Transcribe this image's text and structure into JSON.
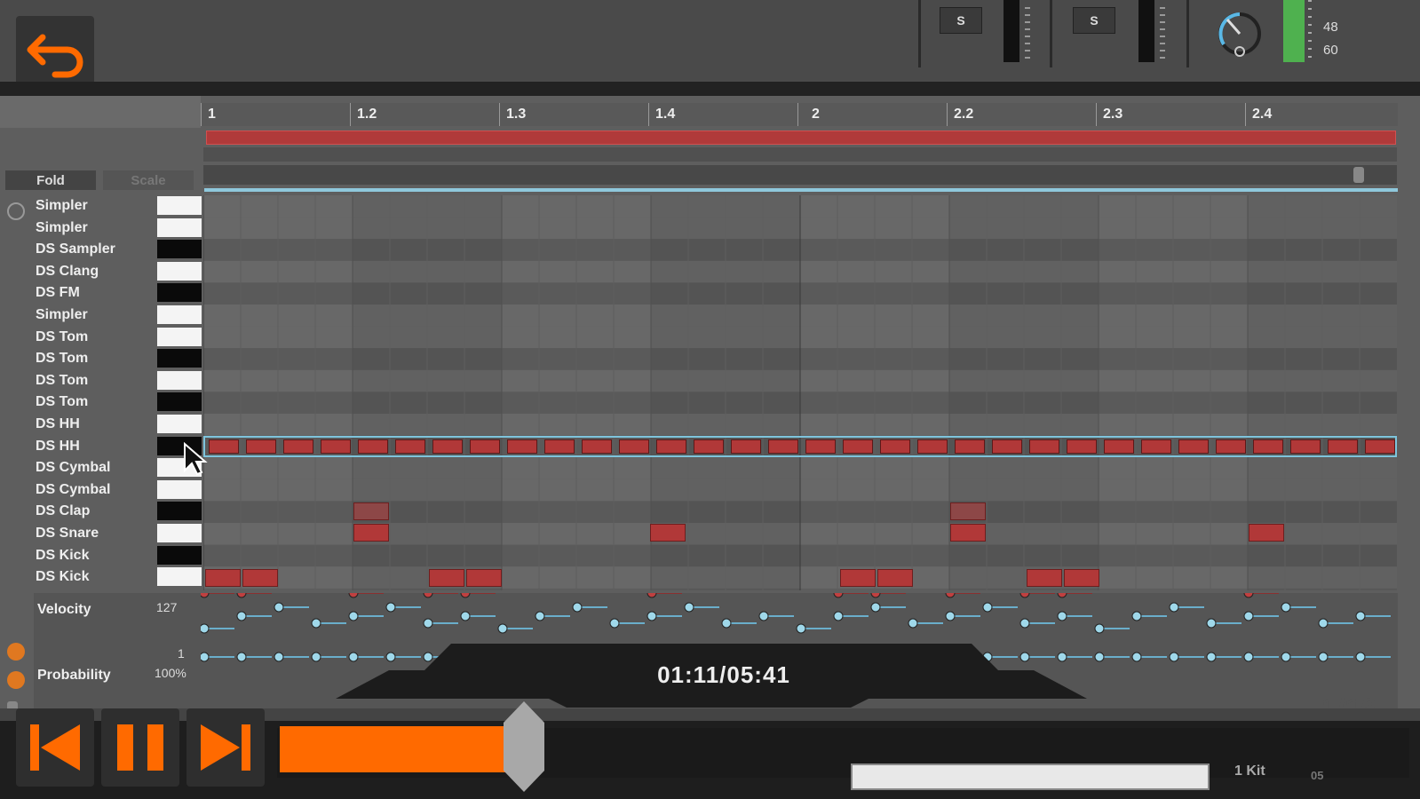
{
  "top_bar": {
    "solo_labels": [
      "S",
      "S"
    ],
    "db_labels": [
      "48",
      "60"
    ]
  },
  "ruler": {
    "bars": [
      "1",
      "1.2",
      "1.3",
      "1.4",
      "2",
      "2.2",
      "2.3",
      "2.4"
    ]
  },
  "piano_roll": {
    "fold_label": "Fold",
    "scale_label": "Scale",
    "rows": [
      {
        "label": "Simpler",
        "key": "white"
      },
      {
        "label": "Simpler",
        "key": "white"
      },
      {
        "label": "DS Sampler",
        "key": "black"
      },
      {
        "label": "DS Clang",
        "key": "white"
      },
      {
        "label": "DS FM",
        "key": "black"
      },
      {
        "label": "Simpler",
        "key": "white"
      },
      {
        "label": "DS Tom",
        "key": "white"
      },
      {
        "label": "DS Tom",
        "key": "black"
      },
      {
        "label": "DS Tom",
        "key": "white"
      },
      {
        "label": "DS Tom",
        "key": "black"
      },
      {
        "label": "DS HH",
        "key": "white"
      },
      {
        "label": "DS HH",
        "key": "black"
      },
      {
        "label": "DS Cymbal",
        "key": "white"
      },
      {
        "label": "DS Cymbal",
        "key": "white"
      },
      {
        "label": "DS Clap",
        "key": "black"
      },
      {
        "label": "DS Snare",
        "key": "white"
      },
      {
        "label": "DS Kick",
        "key": "black"
      },
      {
        "label": "DS Kick",
        "key": "white"
      }
    ],
    "grid_quantization": "1/16"
  },
  "lanes": {
    "velocity_label": "Velocity",
    "velocity_max": "127",
    "velocity_min": "1",
    "probability_label": "Probability",
    "probability_value": "100%"
  },
  "player": {
    "time_display": "01:11/05:41",
    "progress_fraction": 0.204,
    "accent_color": "#ff6a00"
  },
  "bottom": {
    "mini_label": "1 Kit",
    "mini_label2": "05"
  }
}
